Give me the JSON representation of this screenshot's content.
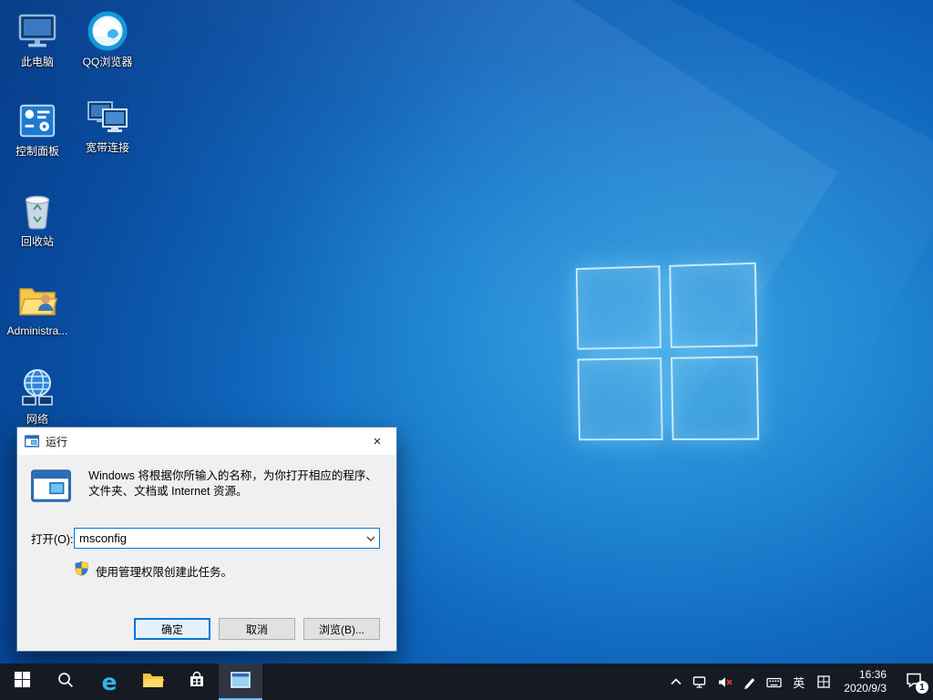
{
  "accent_color": "#0078d7",
  "desktop_icons": [
    {
      "label": "此电脑"
    },
    {
      "label": "QQ浏览器"
    },
    {
      "label": "控制面板"
    },
    {
      "label": "宽带连接"
    },
    {
      "label": "回收站"
    },
    {
      "label": "Administra..."
    },
    {
      "label": "网络"
    }
  ],
  "run_dialog": {
    "title": "运行",
    "close_glyph": "×",
    "description": "Windows 将根据你所输入的名称，为你打开相应的程序、文件夹、文档或 Internet 资源。",
    "open_label": "打开(O):",
    "input_value": "msconfig",
    "admin_note": "使用管理权限创建此任务。",
    "ok_label": "确定",
    "cancel_label": "取消",
    "browse_label": "浏览(B)..."
  },
  "taskbar": {
    "edge_glyph": "e",
    "ime_label": "英",
    "time": "16:36",
    "date": "2020/9/3",
    "notification_badge": "1"
  }
}
